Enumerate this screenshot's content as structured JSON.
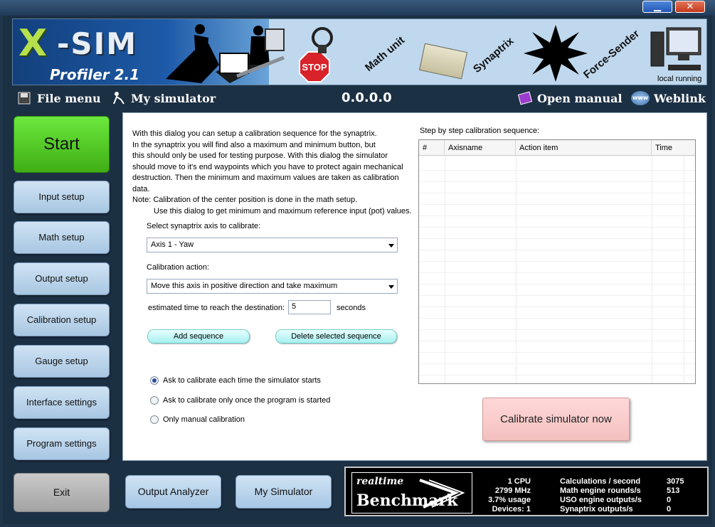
{
  "window": {
    "minimize_glyph": "▁",
    "close_glyph": "✕"
  },
  "banner": {
    "logo_x": "X",
    "logo_sim": "-SIM",
    "logo_subtitle": "Profiler 2.1",
    "stop_label": "STOP",
    "labels": [
      "Math unit",
      "Synaptrix",
      "Force-Sender"
    ],
    "status": "local running"
  },
  "menu": {
    "file": "File menu",
    "simulator": "My simulator",
    "version": "0.0.0.0",
    "manual": "Open manual",
    "weblink": "Weblink",
    "www_badge": "www"
  },
  "nav": {
    "start": "Start",
    "items": [
      "Input setup",
      "Math setup",
      "Output setup",
      "Calibration setup",
      "Gauge setup",
      "Interface settings",
      "Program settings"
    ],
    "exit": "Exit",
    "output_analyzer": "Output Analyzer",
    "my_simulator": "My Simulator"
  },
  "calibration": {
    "intro_lines": [
      "With this dialog you can setup a calibration sequence for the synaptrix.",
      "In the synaptrix you will find also a maximum and minimum button, but",
      "this should only be used for testing purpose. With this dialog the simulator",
      "should move to it's end waypoints which you have to protect again mechanical",
      "destruction. Then the minimum and maximum values are taken as calibration data.",
      "Note: Calibration of the center position is done in the math setup.",
      "Use this dialog to get minimum and maximum reference input (pot) values."
    ],
    "axis_label": "Select synaptrix axis to calibrate:",
    "axis_value": "Axis 1 - Yaw",
    "action_label": "Calibration action:",
    "action_value": "Move this axis in positive direction and take maximum",
    "time_label": "estimated time to reach the destination:",
    "time_value": "5",
    "time_unit": "seconds",
    "add_button": "Add sequence",
    "delete_button": "Delete selected sequence",
    "options": [
      {
        "label": "Ask to calibrate each time the simulator starts",
        "selected": true
      },
      {
        "label": "Ask to calibrate only once the program is started",
        "selected": false
      },
      {
        "label": "Only manual calibration",
        "selected": false
      }
    ],
    "table_title": "Step by step calibration sequence:",
    "columns": [
      "#",
      "Axisname",
      "Action item",
      "Time"
    ],
    "calibrate_button": "Calibrate simulator now"
  },
  "benchmark": {
    "logo_top": "realtime",
    "logo_bottom": "Benchmark",
    "system": [
      "1 CPU",
      "2799 MHz",
      "3.7% usage",
      "Devices: 1"
    ],
    "metric_labels": [
      "Calculations / second",
      "Math engine rounds/s",
      "USO engine outputs/s",
      "Synaptrix outputs/s"
    ],
    "metric_values": [
      "3075",
      "513",
      "0",
      "0"
    ]
  },
  "colors": {
    "start_green": "#4fc424",
    "calibrate_pink": "#f8caca",
    "nav_blue": "#bcd6ee",
    "frame_dark": "#1c3044"
  }
}
